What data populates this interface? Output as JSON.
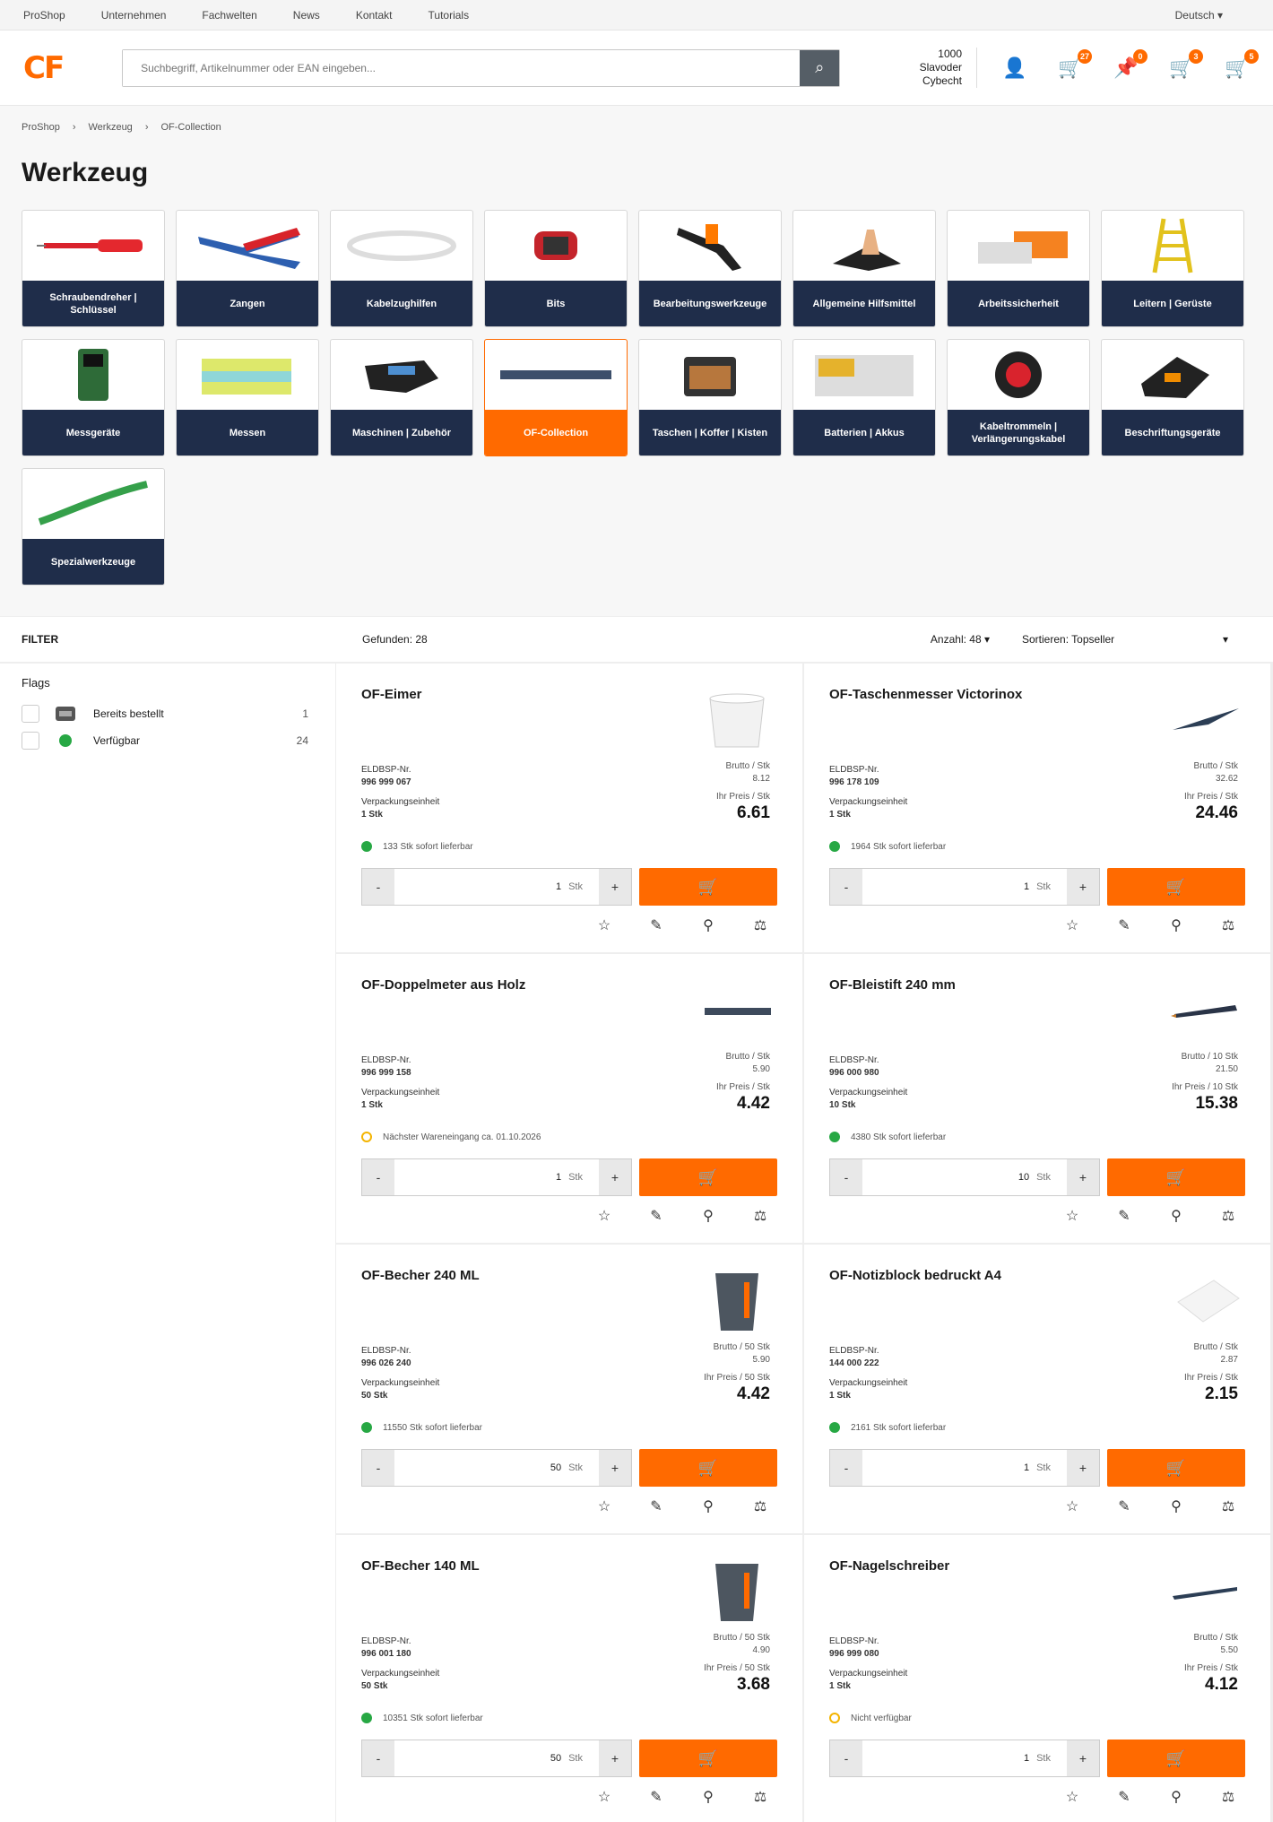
{
  "topbar": {
    "links": [
      "ProShop",
      "Unternehmen",
      "Fachwelten",
      "News",
      "Kontakt",
      "Tutorials"
    ],
    "language": "Deutsch"
  },
  "header": {
    "logo": "CF",
    "search_placeholder": "Suchbegriff, Artikelnummer oder EAN eingeben...",
    "account_id": "1000",
    "account_name": "Slavoder Cybecht",
    "badges": {
      "order_lists": "27",
      "pinned": "0",
      "carts": "3",
      "cart": "5"
    }
  },
  "breadcrumb": [
    "ProShop",
    "Werkzeug",
    "OF-Collection"
  ],
  "page_title": "Werkzeug",
  "categories": [
    {
      "label": "Schraubendreher | Schlüssel",
      "icon": "screwdriver"
    },
    {
      "label": "Zangen",
      "icon": "pliers"
    },
    {
      "label": "Kabelzughilfen",
      "icon": "cable"
    },
    {
      "label": "Bits",
      "icon": "bits"
    },
    {
      "label": "Bearbeitungswerkzeuge",
      "icon": "tool"
    },
    {
      "label": "Allgemeine Hilfsmittel",
      "icon": "helper"
    },
    {
      "label": "Arbeitssicherheit",
      "icon": "safety"
    },
    {
      "label": "Leitern | Gerüste",
      "icon": "ladder"
    },
    {
      "label": "Messgeräte",
      "icon": "meter"
    },
    {
      "label": "Messen",
      "icon": "measure"
    },
    {
      "label": "Maschinen | Zubehör",
      "icon": "machine"
    },
    {
      "label": "OF-Collection",
      "icon": "collection",
      "active": true
    },
    {
      "label": "Taschen | Koffer | Kisten",
      "icon": "case"
    },
    {
      "label": "Batterien | Akkus",
      "icon": "battery"
    },
    {
      "label": "Kabeltrommeln | Verlängerungskabel",
      "icon": "reel"
    },
    {
      "label": "Beschriftungsgeräte",
      "icon": "label"
    },
    {
      "label": "Spezialwerkzeuge",
      "icon": "special"
    }
  ],
  "filter": {
    "title": "FILTER",
    "group": "Flags",
    "options": [
      {
        "label": "Bereits bestellt",
        "count": "1"
      },
      {
        "label": "Verfügbar",
        "count": "24"
      }
    ]
  },
  "listing": {
    "found": "Gefunden: 28",
    "per_page": "Anzahl: 48",
    "sort": "Sortieren: Topseller"
  },
  "products": [
    {
      "name": "OF-Eimer",
      "art_label": "ELDBSP-Nr.",
      "art_no": "996 999 067",
      "pack_label": "Verpackungseinheit",
      "pack": "1 Stk",
      "gross_label": "Brutto / Stk",
      "gross": "8.12",
      "net_label": "Ihr Preis / Stk",
      "net": "6.61",
      "avail": "133 Stk sofort lieferbar",
      "avail_status": "green",
      "qty": "1",
      "unit": "Stk",
      "img": "bucket"
    },
    {
      "name": "OF-Taschenmesser Victorinox",
      "art_label": "ELDBSP-Nr.",
      "art_no": "996 178 109",
      "pack_label": "Verpackungseinheit",
      "pack": "1 Stk",
      "gross_label": "Brutto / Stk",
      "gross": "32.62",
      "net_label": "Ihr Preis / Stk",
      "net": "24.46",
      "avail": "1964 Stk sofort lieferbar",
      "avail_status": "green",
      "qty": "1",
      "unit": "Stk",
      "img": "knife"
    },
    {
      "name": "OF-Doppelmeter aus Holz",
      "art_label": "ELDBSP-Nr.",
      "art_no": "996 999 158",
      "pack_label": "Verpackungseinheit",
      "pack": "1 Stk",
      "gross_label": "Brutto / Stk",
      "gross": "5.90",
      "net_label": "Ihr Preis / Stk",
      "net": "4.42",
      "avail": "Nächster Wareneingang ca. 01.10.2026",
      "avail_status": "orange",
      "qty": "1",
      "unit": "Stk",
      "img": "ruler"
    },
    {
      "name": "OF-Bleistift 240 mm",
      "art_label": "ELDBSP-Nr.",
      "art_no": "996 000 980",
      "pack_label": "Verpackungseinheit",
      "pack": "10 Stk",
      "gross_label": "Brutto / 10 Stk",
      "gross": "21.50",
      "net_label": "Ihr Preis / 10 Stk",
      "net": "15.38",
      "avail": "4380 Stk sofort lieferbar",
      "avail_status": "green",
      "qty": "10",
      "unit": "Stk",
      "img": "pencil"
    },
    {
      "name": "OF-Becher 240 ML",
      "art_label": "ELDBSP-Nr.",
      "art_no": "996 026 240",
      "pack_label": "Verpackungseinheit",
      "pack": "50 Stk",
      "gross_label": "Brutto / 50 Stk",
      "gross": "5.90",
      "net_label": "Ihr Preis / 50 Stk",
      "net": "4.42",
      "avail": "11550 Stk sofort lieferbar",
      "avail_status": "green",
      "qty": "50",
      "unit": "Stk",
      "img": "cup"
    },
    {
      "name": "OF-Notizblock bedruckt A4",
      "art_label": "ELDBSP-Nr.",
      "art_no": "144 000 222",
      "pack_label": "Verpackungseinheit",
      "pack": "1 Stk",
      "gross_label": "Brutto / Stk",
      "gross": "2.87",
      "net_label": "Ihr Preis / Stk",
      "net": "2.15",
      "avail": "2161 Stk sofort lieferbar",
      "avail_status": "green",
      "qty": "1",
      "unit": "Stk",
      "img": "notepad"
    },
    {
      "name": "OF-Becher 140 ML",
      "art_label": "ELDBSP-Nr.",
      "art_no": "996 001 180",
      "pack_label": "Verpackungseinheit",
      "pack": "50 Stk",
      "gross_label": "Brutto / 50 Stk",
      "gross": "4.90",
      "net_label": "Ihr Preis / 50 Stk",
      "net": "3.68",
      "avail": "10351 Stk sofort lieferbar",
      "avail_status": "green",
      "qty": "50",
      "unit": "Stk",
      "img": "cup"
    },
    {
      "name": "OF-Nagelschreiber",
      "art_label": "ELDBSP-Nr.",
      "art_no": "996 999 080",
      "pack_label": "Verpackungseinheit",
      "pack": "1 Stk",
      "gross_label": "Brutto / Stk",
      "gross": "5.50",
      "net_label": "Ihr Preis / Stk",
      "net": "4.12",
      "avail": "Nicht verfügbar",
      "avail_status": "orange",
      "qty": "1",
      "unit": "Stk",
      "img": "pen"
    }
  ],
  "colors": {
    "accent": "#ff6a00",
    "navy": "#1f2d4a",
    "green": "#27a844"
  }
}
